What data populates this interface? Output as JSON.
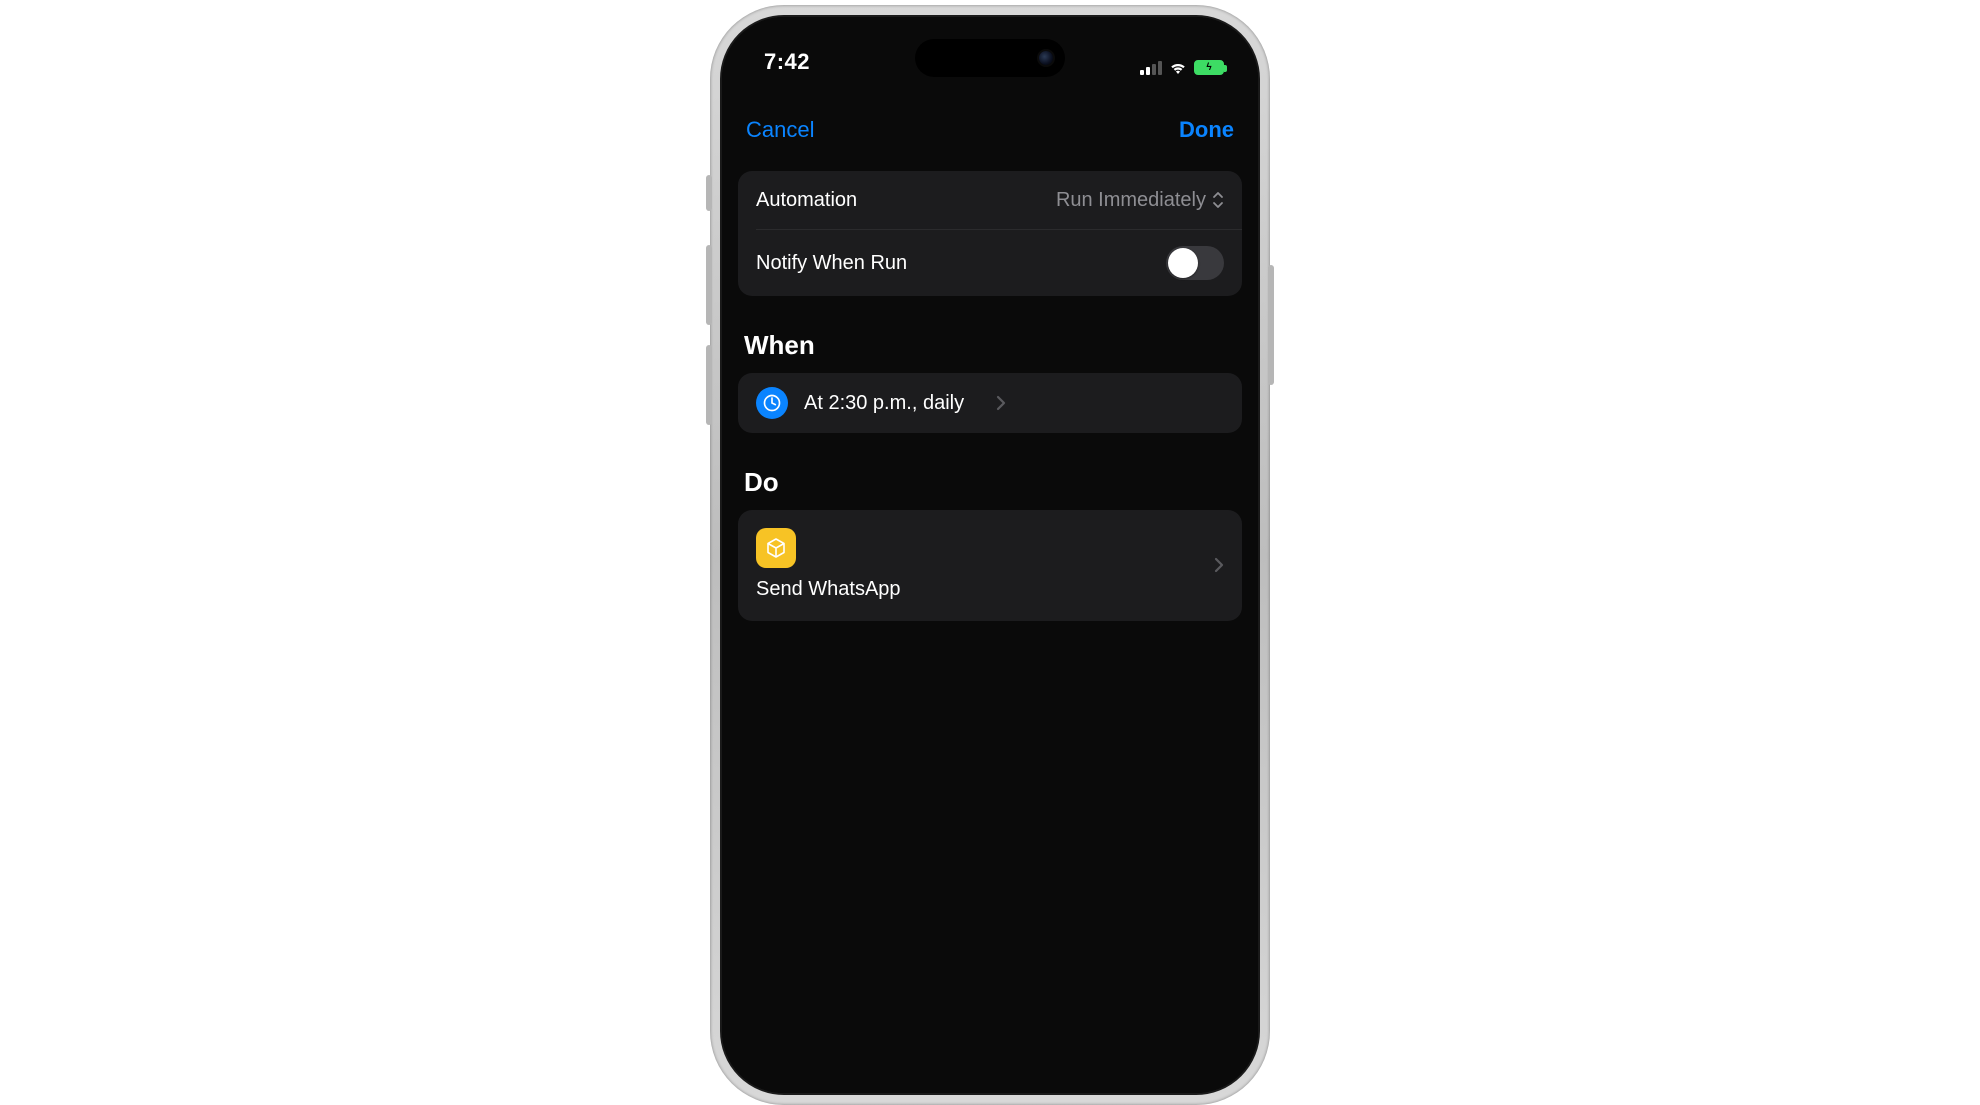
{
  "status": {
    "time": "7:42"
  },
  "nav": {
    "cancel": "Cancel",
    "done": "Done"
  },
  "settings": {
    "automation_label": "Automation",
    "automation_value": "Run Immediately",
    "notify_label": "Notify When Run",
    "notify_on": false
  },
  "sections": {
    "when_title": "When",
    "when_item": "At 2:30 p.m., daily",
    "do_title": "Do",
    "do_item": "Send WhatsApp"
  },
  "icons": {
    "clock": "clock-icon",
    "shortcut": "shortcut-icon"
  }
}
